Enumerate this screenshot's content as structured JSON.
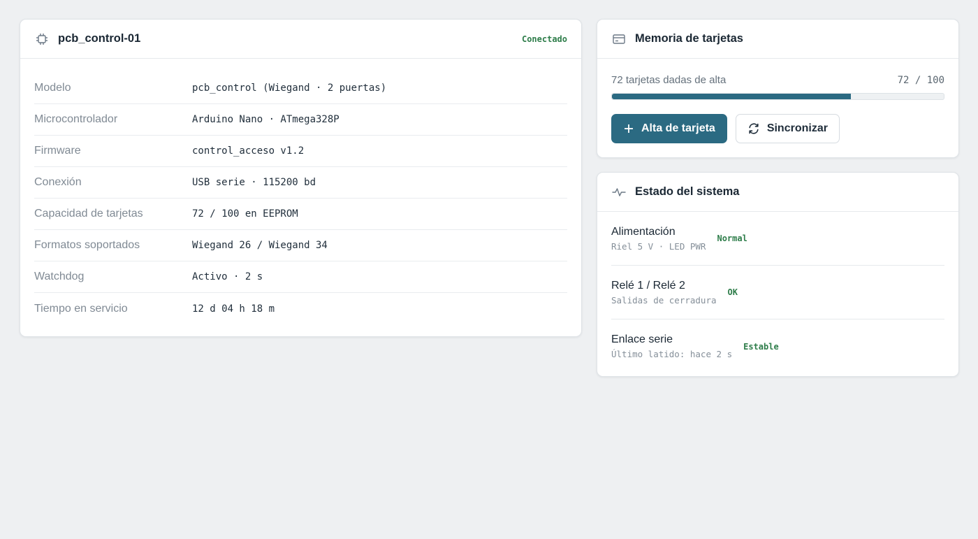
{
  "device": {
    "title": "pcb_control-01",
    "status": "Conectado",
    "icon": "chip-icon",
    "rows": [
      {
        "key": "Modelo",
        "value": "pcb_control (Wiegand · 2 puertas)"
      },
      {
        "key": "Microcontrolador",
        "value": "Arduino Nano · ATmega328P"
      },
      {
        "key": "Firmware",
        "value": "control_acceso v1.2"
      },
      {
        "key": "Conexión",
        "value": "USB serie · 115200 bd"
      },
      {
        "key": "Capacidad de tarjetas",
        "value": "72 / 100 en EEPROM"
      },
      {
        "key": "Formatos soportados",
        "value": "Wiegand 26 / Wiegand 34"
      },
      {
        "key": "Watchdog",
        "value": "Activo · 2 s"
      },
      {
        "key": "Tiempo en servicio",
        "value": "12 d 04 h 18 m"
      }
    ]
  },
  "memory": {
    "title": "Memoria de tarjetas",
    "icon": "card-icon",
    "label": "72 tarjetas dadas de alta",
    "count": "72 / 100",
    "used": 72,
    "capacity": 100,
    "add_button": "Alta de tarjeta",
    "sync_button": "Sincronizar"
  },
  "system": {
    "title": "Estado del sistema",
    "icon": "activity-icon",
    "items": [
      {
        "name": "Alimentación",
        "detail": "Riel 5 V · LED PWR",
        "status": "Normal"
      },
      {
        "name": "Relé 1 / Relé 2",
        "detail": "Salidas de cerradura",
        "status": "OK"
      },
      {
        "name": "Enlace serie",
        "detail": "Último latido: hace 2 s",
        "status": "Estable"
      }
    ]
  },
  "colors": {
    "accent": "#2b6a82",
    "ok": "#2e7d4a",
    "background": "#eef0f2"
  }
}
